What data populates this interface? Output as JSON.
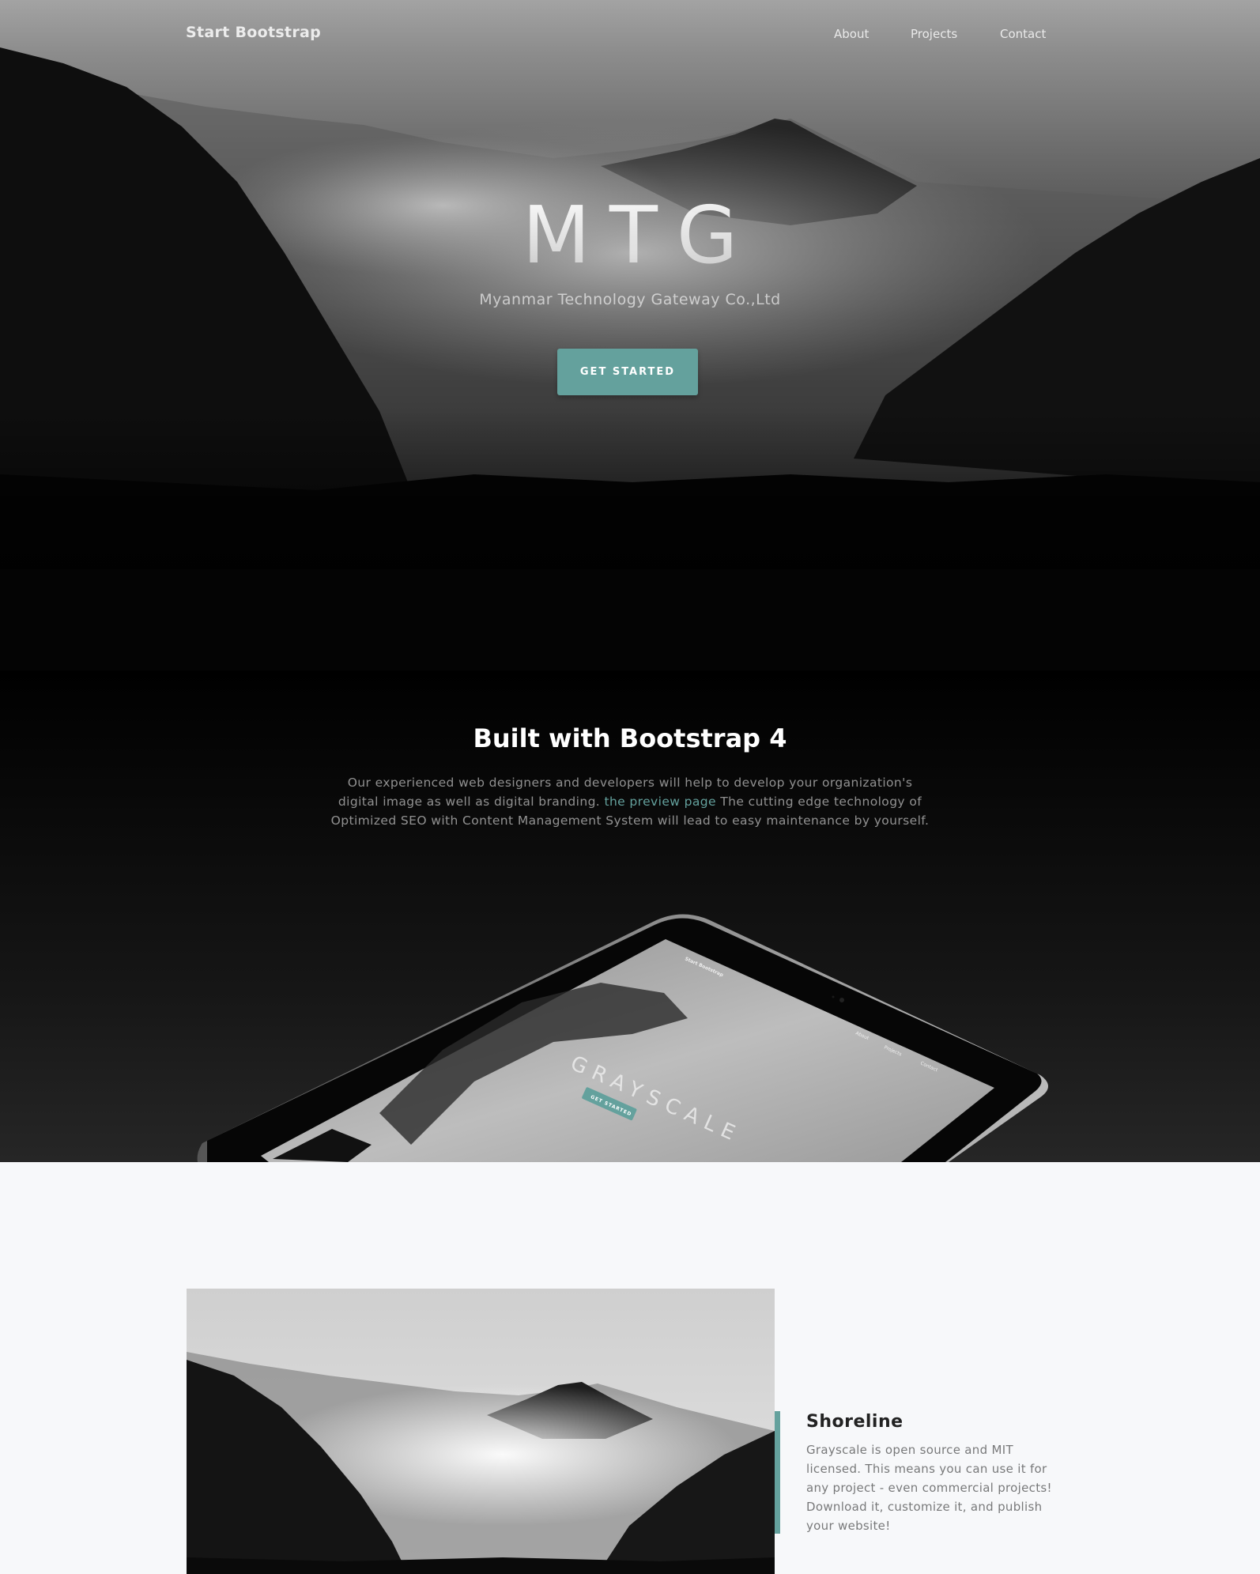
{
  "nav": {
    "brand": "Start Bootstrap",
    "links": [
      "About",
      "Projects",
      "Contact"
    ]
  },
  "hero": {
    "title": "MTG",
    "subtitle": "Myanmar Technology Gateway Co.,Ltd",
    "button": "GET STARTED"
  },
  "about": {
    "title": "Built with Bootstrap 4",
    "text_before": "Our experienced web designers and developers will help to develop your organization's digital image as well as digital branding. ",
    "link": "the preview page",
    "text_after": " The cutting edge technology of Optimized SEO with Content Management System will lead to easy maintenance by yourself.",
    "tablet_screen": {
      "brand": "Start Bootstrap",
      "links": [
        "About",
        "Projects",
        "Contact"
      ],
      "title": "GRAYSCALE",
      "button": "GET STARTED"
    }
  },
  "project": {
    "title": "Shoreline",
    "text": "Grayscale is open source and MIT licensed. This means you can use it for any project - even commercial projects! Download it, customize it, and publish your website!"
  },
  "colors": {
    "accent": "#64a19d",
    "hero_bg_dark": "#000000",
    "projects_bg": "#f7f8fa"
  }
}
